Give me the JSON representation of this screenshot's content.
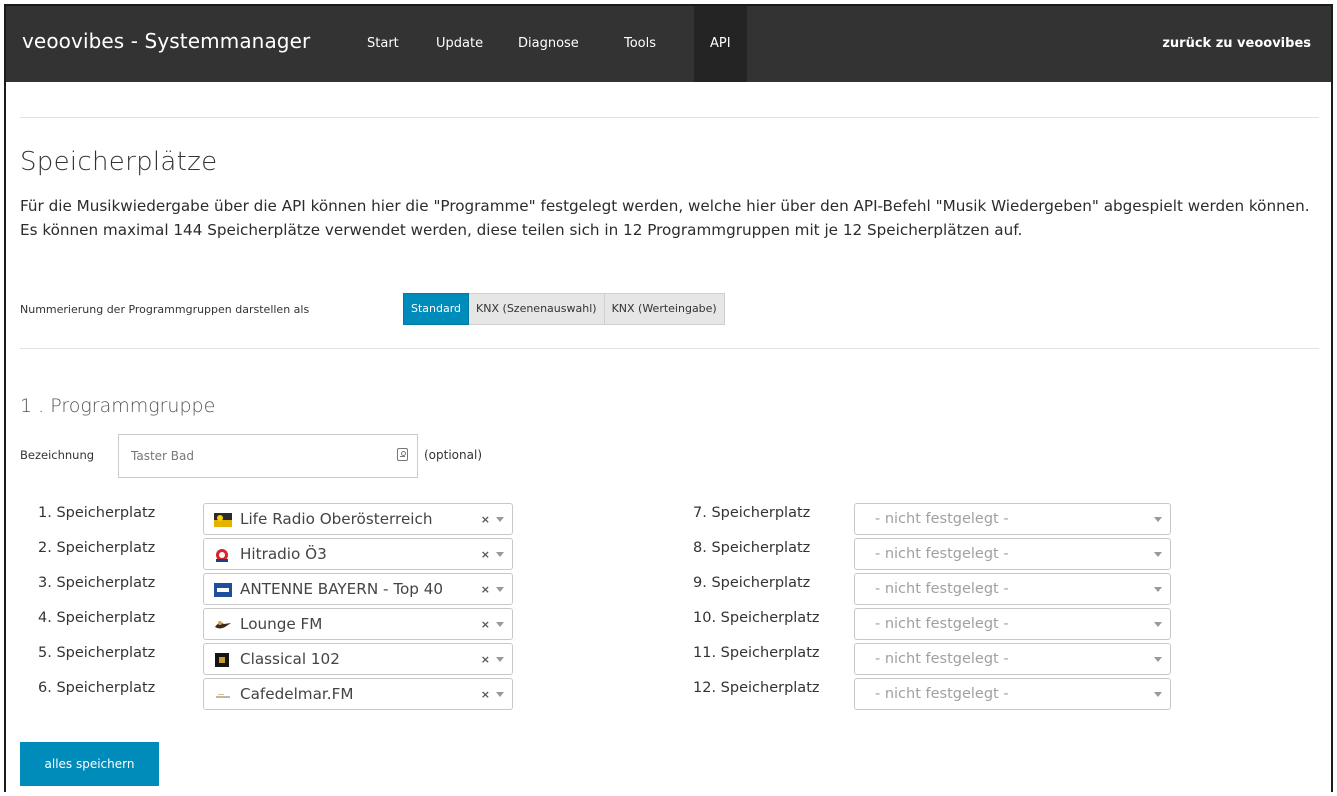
{
  "navbar": {
    "brand": "veoovibes - Systemmanager",
    "items": [
      {
        "label": "Start",
        "active": false
      },
      {
        "label": "Update",
        "active": false
      },
      {
        "label": "Diagnose",
        "active": false
      },
      {
        "label": "Tools",
        "active": false
      },
      {
        "label": "API",
        "active": true
      }
    ],
    "back_label": "zurück zu veoovibes"
  },
  "page": {
    "title": "Speicherplätze",
    "description": "Für die Musikwiedergabe über die API können hier die \"Programme\" festgelegt werden, welche hier über den API-Befehl \"Musik Wiedergeben\" abgespielt werden können. Es können maximal 144 Speicherplätze verwendet werden, diese teilen sich in 12 Programmgruppen mit je 12 Speicherplätzen auf.",
    "numbering_label": "Nummerierung der Programmgruppen darstellen als",
    "numbering_options": [
      {
        "label": "Standard",
        "active": true
      },
      {
        "label": "KNX (Szenenauswahl)",
        "active": false
      },
      {
        "label": "KNX (Werteingabe)",
        "active": false
      }
    ]
  },
  "group": {
    "title": "1 . Programmgruppe",
    "name_label": "Bezeichnung",
    "name_value": "",
    "name_placeholder": "Taster Bad",
    "optional_label": "(optional)",
    "slots_left": [
      {
        "label": "1. Speicherplatz",
        "value": "Life Radio Oberösterreich",
        "icon": "life-radio-logo"
      },
      {
        "label": "2. Speicherplatz",
        "value": "Hitradio Ö3",
        "icon": "hitradio-o3-logo"
      },
      {
        "label": "3. Speicherplatz",
        "value": "ANTENNE BAYERN - Top 40",
        "icon": "antenne-bayern-logo"
      },
      {
        "label": "4. Speicherplatz",
        "value": "Lounge FM",
        "icon": "lounge-fm-logo"
      },
      {
        "label": "5. Speicherplatz",
        "value": "Classical 102",
        "icon": "classical-102-logo"
      },
      {
        "label": "6. Speicherplatz",
        "value": "Cafedelmar.FM",
        "icon": "cafedelmar-logo"
      }
    ],
    "slots_right": [
      {
        "label": "7. Speicherplatz",
        "placeholder": "- nicht festgelegt -"
      },
      {
        "label": "8. Speicherplatz",
        "placeholder": "- nicht festgelegt -"
      },
      {
        "label": "9. Speicherplatz",
        "placeholder": "- nicht festgelegt -"
      },
      {
        "label": "10. Speicherplatz",
        "placeholder": "- nicht festgelegt -"
      },
      {
        "label": "11. Speicherplatz",
        "placeholder": "- nicht festgelegt -"
      },
      {
        "label": "12. Speicherplatz",
        "placeholder": "- nicht festgelegt -"
      }
    ],
    "clear_symbol": "×"
  },
  "actions": {
    "save_all": "alles speichern"
  },
  "colors": {
    "navbar_bg": "#333333",
    "accent": "#008cba"
  }
}
